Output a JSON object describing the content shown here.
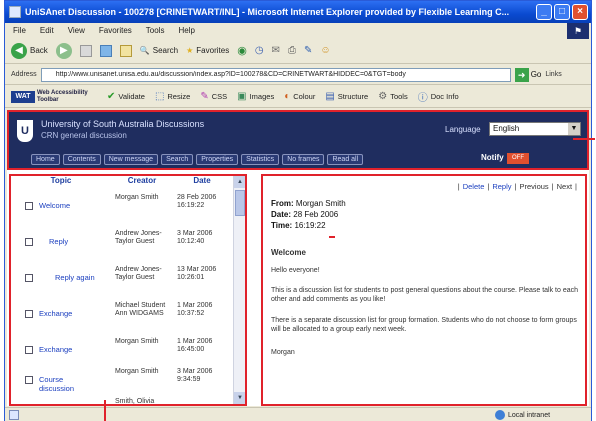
{
  "window": {
    "title": "UniSAnet Discussion - 100278 [CRINETWART/INL] - Microsoft Internet Explorer provided by Flexible Learning C..."
  },
  "menu": [
    "File",
    "Edit",
    "View",
    "Favorites",
    "Tools",
    "Help"
  ],
  "toolbar": {
    "back_label": "Back",
    "search_label": "Search",
    "favorites_label": "Favorites"
  },
  "address": {
    "label": "Address",
    "url": "http://www.unisanet.unisa.edu.au/discussion/index.asp?ID=100278&CD=CRINETWART&HIDDEC=0&TGT=body",
    "go_label": "Go",
    "links_label": "Links"
  },
  "acc_toolbar": {
    "logo_text": "WAT",
    "logo_label": "Web Accessibility Toolbar",
    "items": [
      "Validate",
      "Resize",
      "CSS",
      "Images",
      "Colour",
      "Structure",
      "Tools",
      "Doc Info"
    ]
  },
  "header": {
    "title": "University of South Australia Discussions",
    "subtitle": "CRN general discussion",
    "language_label": "Language",
    "language_value": "English",
    "nav": [
      "Home",
      "Contents",
      "New message",
      "Search",
      "Properties",
      "Statistics",
      "No frames",
      "Read all"
    ],
    "notify_label": "Notify",
    "notify_badge": "OFF"
  },
  "topics": {
    "columns": [
      "Topic",
      "Creator",
      "Date"
    ],
    "rows": [
      {
        "topic": "Welcome",
        "creator": "Morgan Smith",
        "date": "28 Feb 2006 16:19:22"
      },
      {
        "topic": "Reply",
        "creator": "Andrew Jones-Taylor Guest",
        "date": "3 Mar 2006 10:12:40"
      },
      {
        "topic": "Reply again",
        "creator": "Andrew Jones-Taylor Guest",
        "date": "13 Mar 2006 10:26:01"
      },
      {
        "topic": "Exchange",
        "creator": "Michael Student Ann WIDGAMS",
        "date": "1 Mar 2006 10:37:52"
      },
      {
        "topic": "Exchange",
        "creator": "Morgan Smith",
        "date": "1 Mar 2006 16:45:00"
      },
      {
        "topic": "Course discussion",
        "creator": "Morgan Smith",
        "date": "3 Mar 2006 9:34:59"
      },
      {
        "topic": "",
        "creator": "Smith, Olivia",
        "date": ""
      }
    ]
  },
  "message": {
    "nav": [
      "Delete",
      "Reply",
      "Previous",
      "Next"
    ],
    "from_label": "From:",
    "from": "Morgan Smith",
    "date_label": "Date:",
    "date": "28 Feb 2006",
    "time_label": "Time:",
    "time": "16:19:22",
    "subject": "Welcome",
    "body": [
      "Hello everyone!",
      "This is a discussion list for students to post general questions about the course. Please talk to each other and add comments as you like!",
      "There is a separate discussion list for group formation. Students who do not choose to form groups will be allocated to a group early next week.",
      "Morgan"
    ]
  },
  "status": {
    "zone": "Local intranet"
  }
}
